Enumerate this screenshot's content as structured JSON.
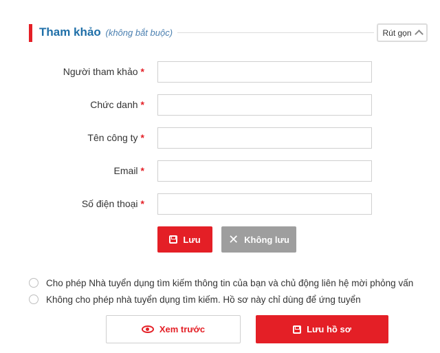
{
  "section": {
    "title": "Tham khảo",
    "subtitle": "(không bắt buộc)",
    "collapse_label": "Rút gọn"
  },
  "form": {
    "fields": [
      {
        "label": "Người tham khảo",
        "required_mark": "*",
        "value": ""
      },
      {
        "label": "Chức danh",
        "required_mark": "*",
        "value": ""
      },
      {
        "label": "Tên công ty",
        "required_mark": "*",
        "value": ""
      },
      {
        "label": "Email",
        "required_mark": "*",
        "value": ""
      },
      {
        "label": "Số điện thoại",
        "required_mark": "*",
        "value": ""
      }
    ],
    "save_label": "Lưu",
    "cancel_label": "Không lưu"
  },
  "privacy": {
    "options": [
      {
        "label": "Cho phép Nhà tuyển dụng tìm kiếm thông tin của bạn và chủ động liên hệ mời phỏng vấn",
        "selected": false
      },
      {
        "label": "Không cho phép nhà tuyển dụng tìm kiếm. Hồ sơ này chỉ dùng để ứng tuyển",
        "selected": false
      }
    ]
  },
  "actions": {
    "preview_label": "Xem trước",
    "save_cv_label": "Lưu hồ sơ"
  },
  "icons": {
    "collapse": "chevron-up-icon",
    "save": "floppy-disk-icon",
    "cancel": "close-icon",
    "preview": "eye-icon"
  },
  "colors": {
    "accent": "#e41f26",
    "title": "#1f6fa8",
    "neutral_button": "#9e9e9e"
  }
}
